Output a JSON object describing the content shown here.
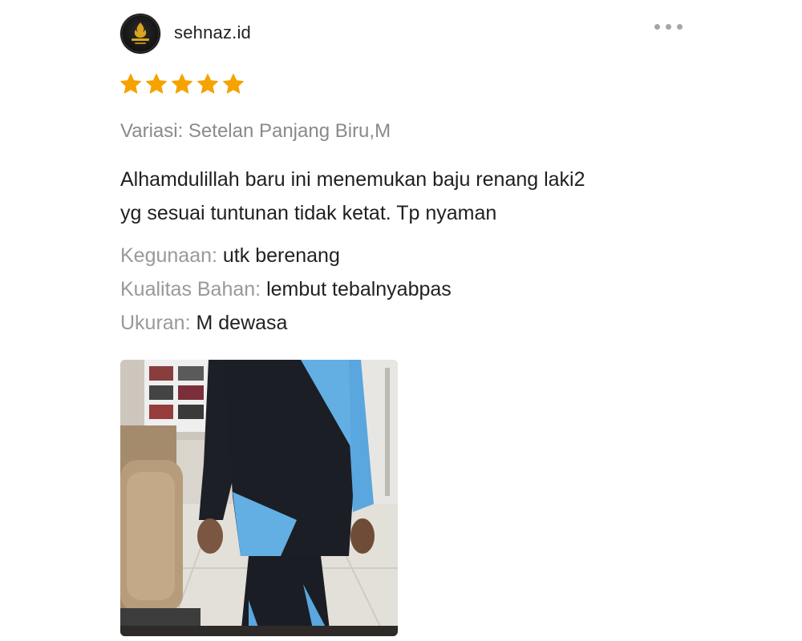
{
  "review": {
    "username": "sehnaz.id",
    "rating": 5,
    "rating_max": 5,
    "star_color": "#f6a200",
    "variation": "Variasi: Setelan Panjang Biru,M",
    "comment_lines": [
      "Alhamdulillah baru ini menemukan baju renang laki2",
      "yg sesuai tuntunan tidak ketat. Tp nyaman"
    ],
    "attributes": [
      {
        "label": "Kegunaan:",
        "value": "utk berenang"
      },
      {
        "label": "Kualitas Bahan:",
        "value": "lembut tebalnyabpas"
      },
      {
        "label": "Ukuran:",
        "value": "M dewasa"
      }
    ],
    "icons": {
      "avatar": "shop-logo-icon",
      "more": "more-horizontal-icon",
      "star": "star-icon"
    }
  }
}
